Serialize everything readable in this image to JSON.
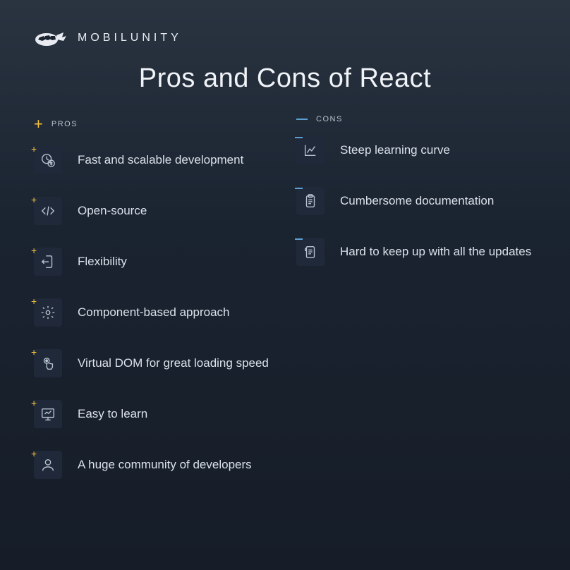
{
  "brand": "MOBILUNITY",
  "title": "Pros and Cons of React",
  "columns": {
    "pros": {
      "label": "PROS",
      "items": [
        "Fast and scalable development",
        "Open-source",
        "Flexibility",
        "Component-based approach",
        "Virtual DOM for great loading speed",
        "Easy to learn",
        "A huge community of developers"
      ]
    },
    "cons": {
      "label": "CONS",
      "items": [
        "Steep learning curve",
        "Cumbersome documentation",
        "Hard to keep up with all the updates"
      ]
    }
  }
}
